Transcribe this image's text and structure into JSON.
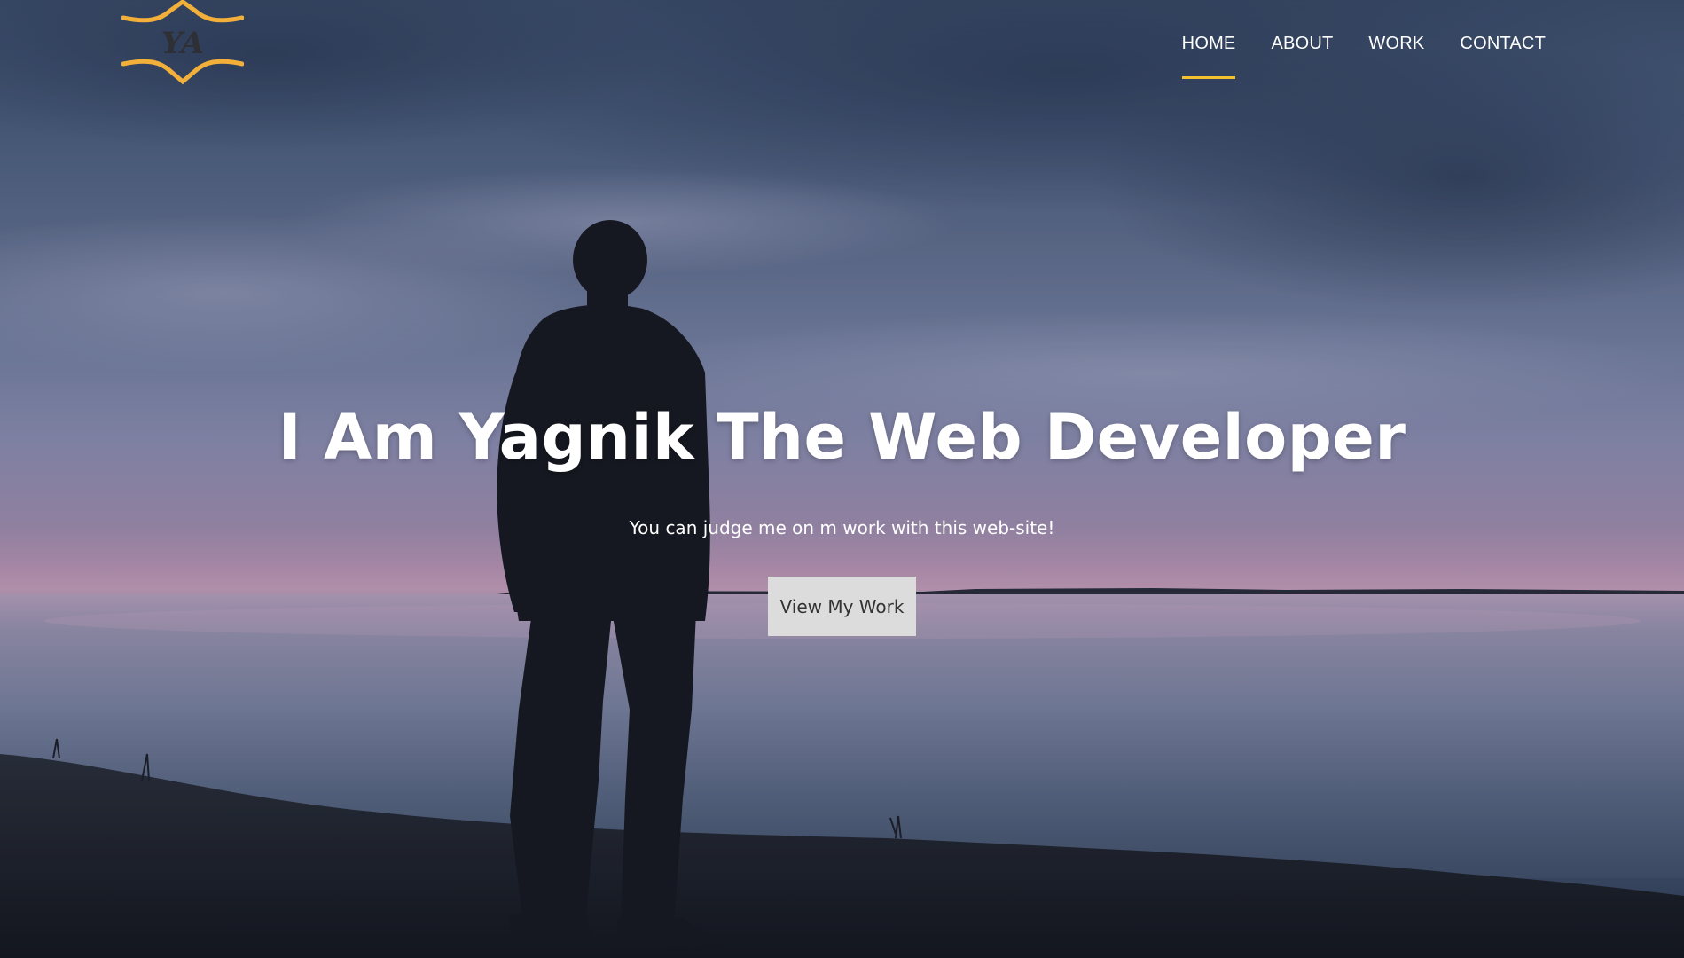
{
  "logo": {
    "text": "YA",
    "accent_color": "#f2b03a",
    "text_color": "#2f2f36"
  },
  "nav": {
    "items": [
      {
        "label": "HOME",
        "active": true
      },
      {
        "label": "ABOUT",
        "active": false
      },
      {
        "label": "WORK",
        "active": false
      },
      {
        "label": "CONTACT",
        "active": false
      }
    ],
    "active_underline_color": "#f2c12e"
  },
  "hero": {
    "headline": "I Am Yagnik The Web Developer",
    "subtitle": "You can judge me on m work with this web-site!",
    "cta_label": "View My Work",
    "background": "silhouette-person-lake-dusk-photo"
  }
}
